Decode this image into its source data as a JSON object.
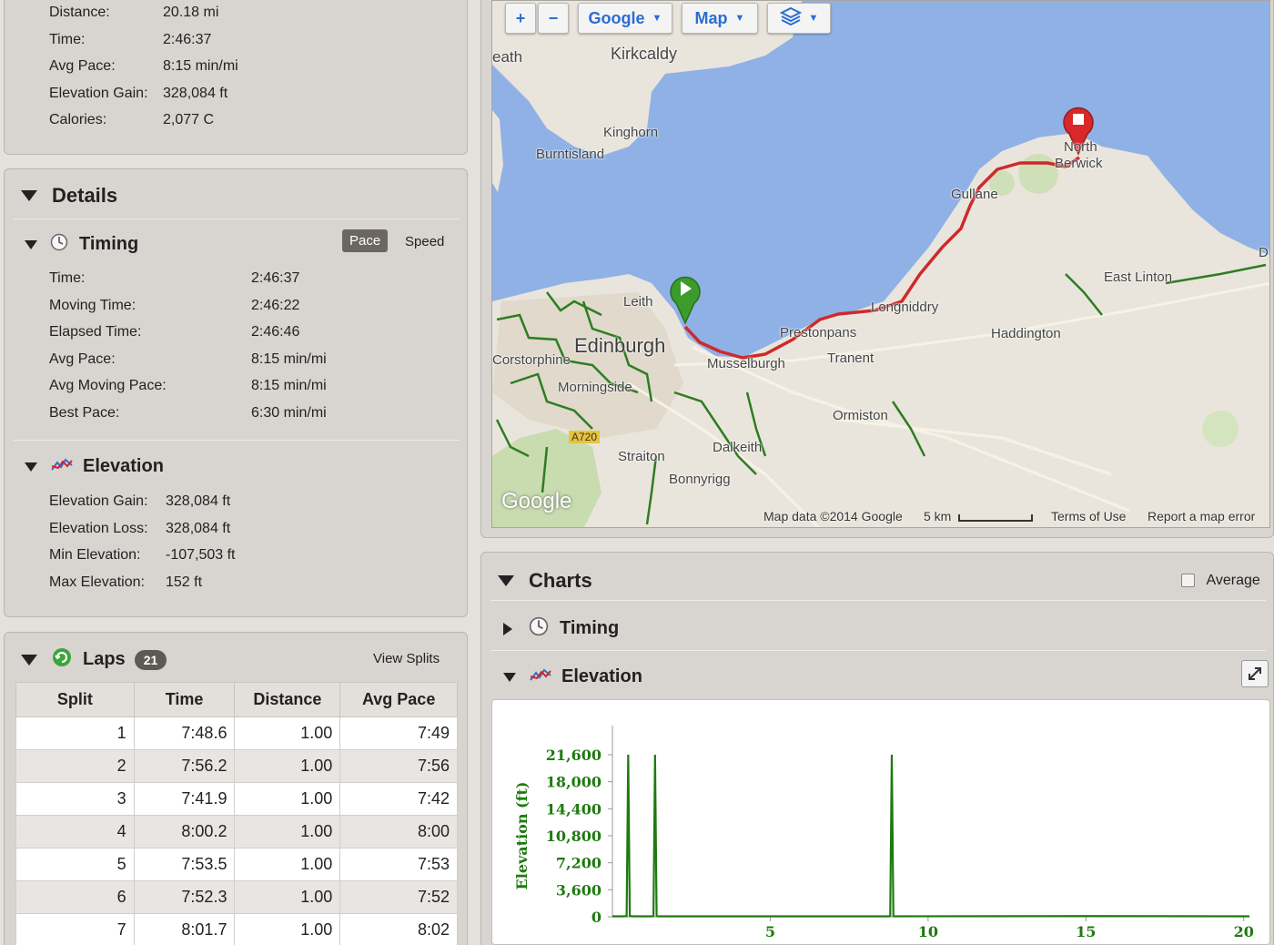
{
  "summary": {
    "rows": [
      {
        "label": "Distance:",
        "value": "20.18 mi"
      },
      {
        "label": "Time:",
        "value": "2:46:37"
      },
      {
        "label": "Avg Pace:",
        "value": "8:15 min/mi"
      },
      {
        "label": "Elevation Gain:",
        "value": "328,084 ft"
      },
      {
        "label": "Calories:",
        "value": "2,077 C"
      }
    ]
  },
  "details": {
    "title": "Details",
    "timing": {
      "title": "Timing",
      "pace_label": "Pace",
      "speed_label": "Speed",
      "rows": [
        {
          "label": "Time:",
          "value": "2:46:37"
        },
        {
          "label": "Moving Time:",
          "value": "2:46:22"
        },
        {
          "label": "Elapsed Time:",
          "value": "2:46:46"
        },
        {
          "label": "Avg Pace:",
          "value": "8:15 min/mi"
        },
        {
          "label": "Avg Moving Pace:",
          "value": "8:15 min/mi"
        },
        {
          "label": "Best Pace:",
          "value": "6:30 min/mi"
        }
      ]
    },
    "elevation": {
      "title": "Elevation",
      "rows": [
        {
          "label": "Elevation Gain:",
          "value": "328,084 ft"
        },
        {
          "label": "Elevation Loss:",
          "value": "328,084 ft"
        },
        {
          "label": "Min Elevation:",
          "value": "-107,503 ft"
        },
        {
          "label": "Max Elevation:",
          "value": "152 ft"
        }
      ]
    }
  },
  "laps": {
    "title": "Laps",
    "count": "21",
    "view_splits": "View Splits",
    "columns": [
      "Split",
      "Time",
      "Distance",
      "Avg Pace"
    ],
    "rows": [
      [
        "1",
        "7:48.6",
        "1.00",
        "7:49"
      ],
      [
        "2",
        "7:56.2",
        "1.00",
        "7:56"
      ],
      [
        "3",
        "7:41.9",
        "1.00",
        "7:42"
      ],
      [
        "4",
        "8:00.2",
        "1.00",
        "8:00"
      ],
      [
        "5",
        "7:53.5",
        "1.00",
        "7:53"
      ],
      [
        "6",
        "7:52.3",
        "1.00",
        "7:52"
      ],
      [
        "7",
        "8:01.7",
        "1.00",
        "8:02"
      ]
    ]
  },
  "map": {
    "zoom_in": "+",
    "zoom_out": "−",
    "provider": "Google",
    "type": "Map",
    "labels": [
      "Kirkcaldy",
      "Kinghorn",
      "Burntisland",
      "North",
      "Berwick",
      "Gullane",
      "East Linton",
      "Longniddry",
      "Haddington",
      "Prestonpans",
      "Tranent",
      "Musselburgh",
      "Edinburgh",
      "Leith",
      "Corstorphine",
      "Morningside",
      "Ormiston",
      "Dalkeith",
      "Straiton",
      "Bonnyrigg",
      "A720",
      "Google",
      "eath",
      "Dunbar"
    ],
    "attribution": "Map data ©2014 Google",
    "scale": "5 km",
    "terms": "Terms of Use",
    "report": "Report a map error",
    "route_color": "#d0292a",
    "water_color": "#8fb1e6",
    "land_color": "#e9e5dc"
  },
  "charts": {
    "title": "Charts",
    "average_label": "Average",
    "timing_label": "Timing",
    "elevation_label": "Elevation"
  },
  "chart_data": {
    "type": "line",
    "ylabel": "Elevation (ft)",
    "xlim": [
      0,
      20.18
    ],
    "ylim": [
      0,
      21600
    ],
    "yticks": [
      0,
      3600,
      7200,
      10800,
      14400,
      18000,
      21600
    ],
    "xticks": [
      5,
      10,
      15,
      20
    ],
    "line_color": "#1f7a10",
    "series": [
      {
        "x": [
          0,
          0.35,
          0.45,
          0.5,
          0.55,
          0.65,
          1.25,
          1.3,
          1.35,
          1.4,
          1.45,
          8.75,
          8.8,
          8.85,
          8.9,
          8.95,
          12,
          15,
          18,
          20.18
        ],
        "y": [
          60,
          60,
          100,
          21600,
          100,
          60,
          60,
          100,
          21600,
          100,
          60,
          60,
          100,
          21600,
          100,
          60,
          80,
          90,
          80,
          60
        ]
      }
    ]
  }
}
